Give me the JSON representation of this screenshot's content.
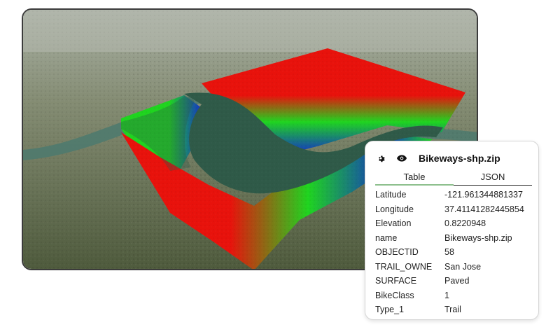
{
  "popup": {
    "title": "Bikeways-shp.zip",
    "icons": {
      "settings": "gear-icon",
      "visibility": "eye-icon"
    },
    "tabs": [
      {
        "label": "Table",
        "active": true
      },
      {
        "label": "JSON",
        "active": false
      }
    ],
    "rows": [
      {
        "key": "Latitude",
        "value": "-121.961344881337"
      },
      {
        "key": "Longitude",
        "value": "37.41141282445854"
      },
      {
        "key": "Elevation",
        "value": "0.8220948"
      },
      {
        "key": "name",
        "value": "Bikeways-shp.zip"
      },
      {
        "key": "OBJECTID",
        "value": "58"
      },
      {
        "key": "TRAIL_OWNE",
        "value": "San Jose"
      },
      {
        "key": "SURFACE",
        "value": "Paved"
      },
      {
        "key": "BikeClass",
        "value": "1"
      },
      {
        "key": "Type_1",
        "value": "Trail"
      }
    ]
  },
  "colors": {
    "elevation_high": "#e8120c",
    "elevation_mid": "#1fd41f",
    "elevation_low": "#1431c8",
    "water": "#2f5a48",
    "tab_active_underline": "#8dbf8d"
  }
}
